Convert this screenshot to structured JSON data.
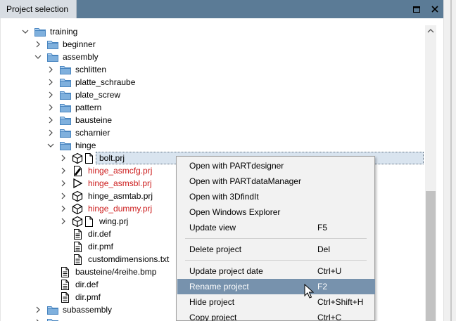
{
  "panel": {
    "title": "Project selection",
    "maximize_icon": "maximize-icon",
    "close_icon": "close-icon"
  },
  "tree": {
    "training": "training",
    "beginner": "beginner",
    "assembly": "assembly",
    "schlitten": "schlitten",
    "platte_schraube": "platte_schraube",
    "plate_screw": "plate_screw",
    "pattern": "pattern",
    "bausteine": "bausteine",
    "scharnier": "scharnier",
    "hinge": "hinge",
    "bolt": "bolt.prj",
    "hinge_asmcfg": "hinge_asmcfg.prj",
    "hinge_asmsbl": "hinge_asmsbl.prj",
    "hinge_asmtab": "hinge_asmtab.prj",
    "hinge_dummy": "hinge_dummy.prj",
    "wing": "wing.prj",
    "dir_def_1": "dir.def",
    "dir_pmf_1": "dir.pmf",
    "customdimensions": "customdimensions.txt",
    "bausteine_bmp": "bausteine/4reihe.bmp",
    "dir_def_2": "dir.def",
    "dir_pmf_2": "dir.pmf",
    "subassembly": "subassembly"
  },
  "context_menu": {
    "open_partdesigner": "Open with PARTdesigner",
    "open_partdatamanager": "Open with PARTdataManager",
    "open_3dfindit": "Open with 3DfindIt",
    "open_explorer": "Open Windows Explorer",
    "update_view": "Update view",
    "update_view_key": "F5",
    "delete_project": "Delete project",
    "delete_project_key": "Del",
    "update_project_date": "Update project date",
    "update_project_date_key": "Ctrl+U",
    "rename_project": "Rename project",
    "rename_project_key": "F2",
    "hide_project": "Hide project",
    "hide_project_key": "Ctrl+Shift+H",
    "copy_project": "Copy project",
    "copy_project_key": "Ctrl+C"
  },
  "colors": {
    "header": "#5b7b96",
    "highlight": "#7792ad",
    "folder": "#7fb0dd",
    "error_text": "#cc1b1b"
  }
}
